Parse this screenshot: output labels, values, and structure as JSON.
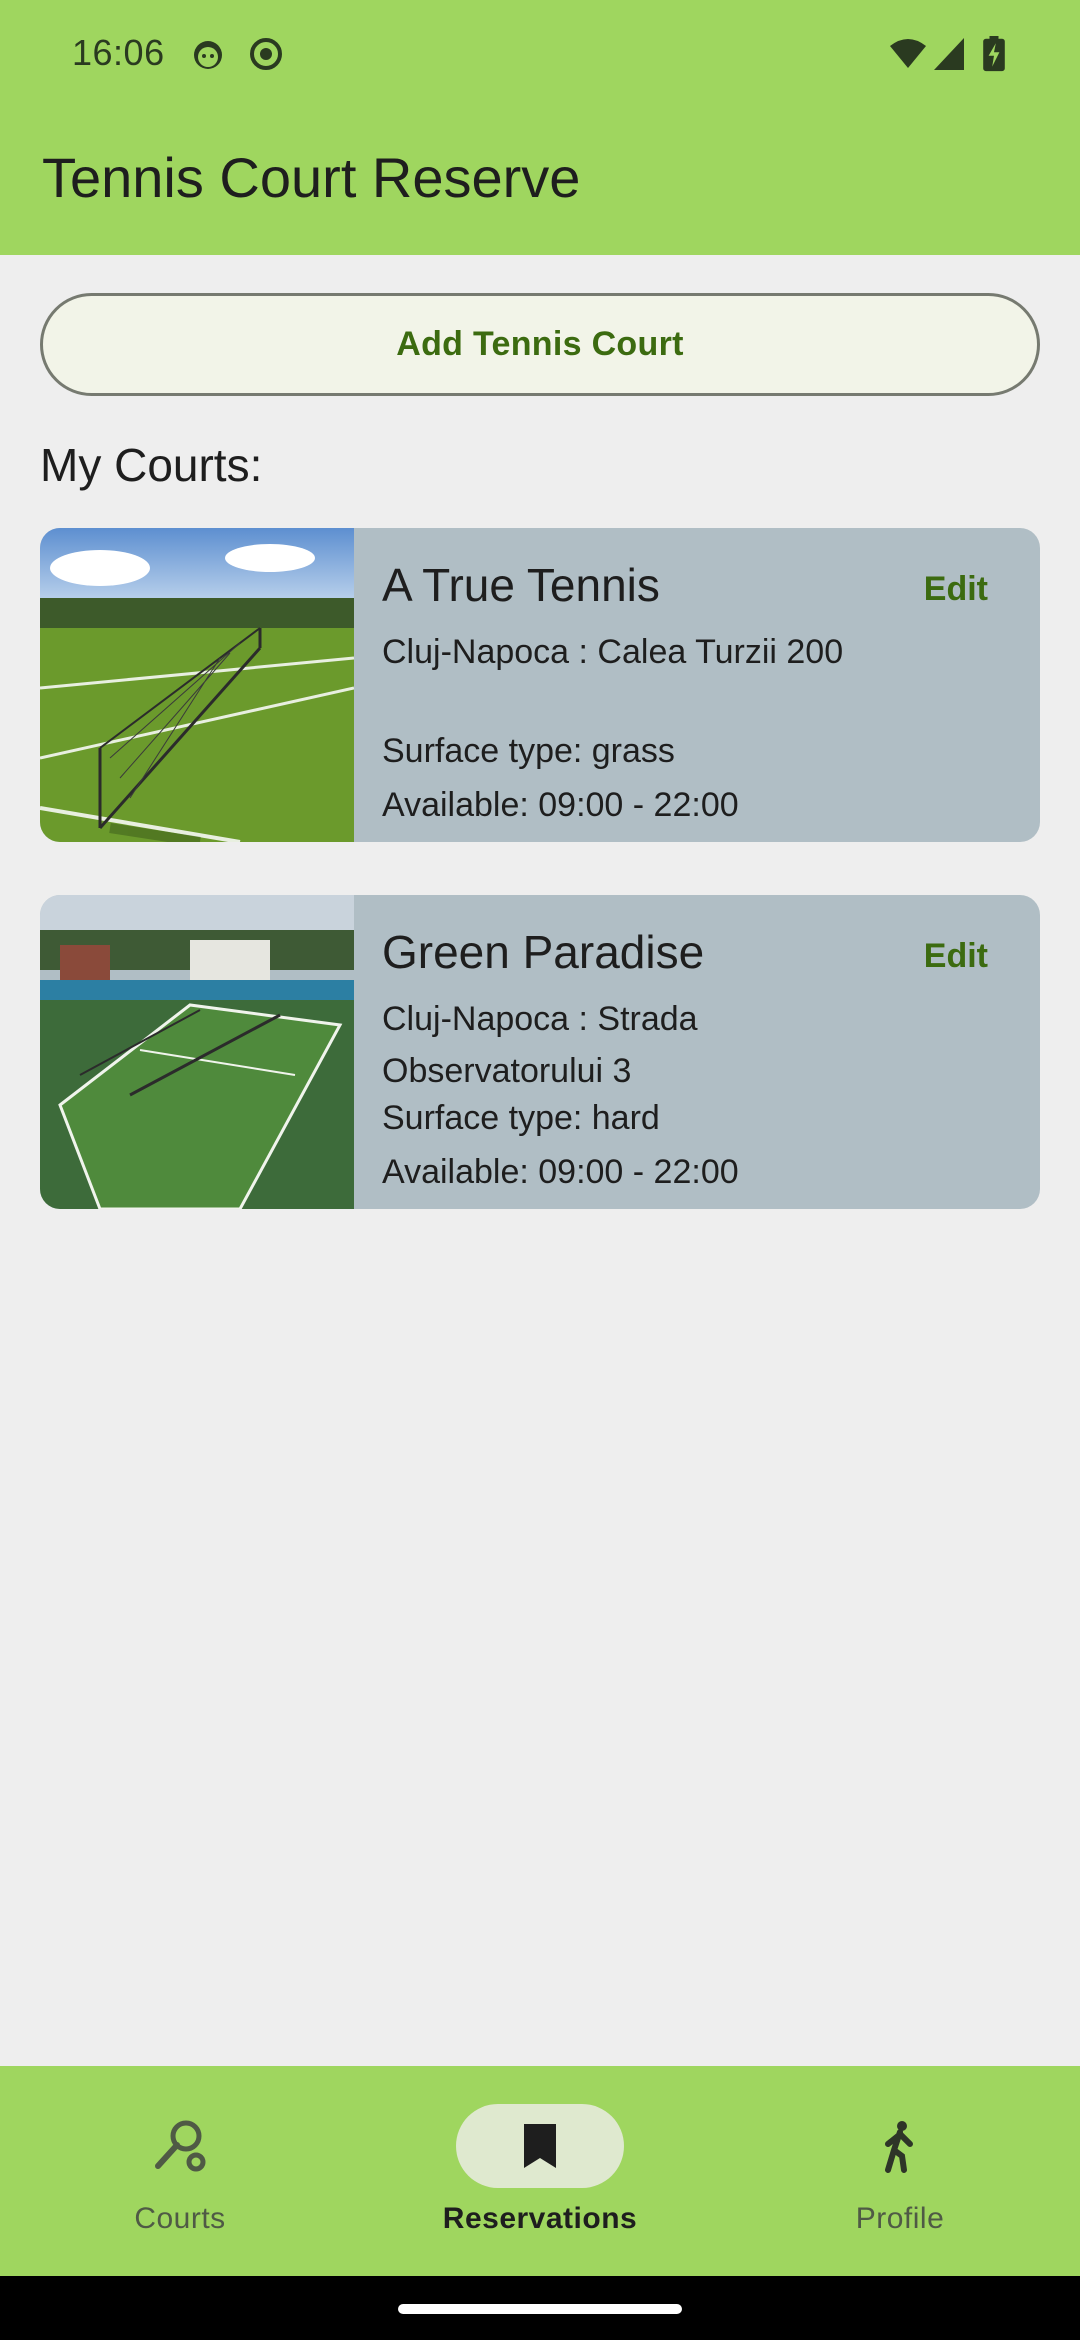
{
  "status_bar": {
    "time": "16:06"
  },
  "app_bar": {
    "title": "Tennis Court Reserve"
  },
  "actions": {
    "add_court_label": "Add Tennis Court"
  },
  "section": {
    "my_courts_title": "My Courts:"
  },
  "courts": [
    {
      "name": "A True Tennis",
      "edit_label": "Edit",
      "address": "Cluj-Napoca : Calea Turzii 200",
      "surface": "Surface type: grass",
      "available": "Available: 09:00 - 22:00",
      "photo_icon": "grass-court-photo"
    },
    {
      "name": "Green Paradise",
      "edit_label": "Edit",
      "address": "Cluj-Napoca : Strada Observatorului 3",
      "surface": "Surface type: hard",
      "available": "Available: 09:00 - 22:00",
      "photo_icon": "hard-court-photo"
    }
  ],
  "bottom_nav": {
    "items": [
      {
        "label": "Courts",
        "icon": "racket-icon",
        "active": false
      },
      {
        "label": "Reservations",
        "icon": "bookmark-icon",
        "active": true
      },
      {
        "label": "Profile",
        "icon": "walking-person-icon",
        "active": false
      }
    ]
  },
  "colors": {
    "app_bar": "#9fd65f",
    "background": "#eeeeee",
    "card": "#b0bec5",
    "accent_text": "#3c6b10",
    "active_pill": "#dfe9cf"
  }
}
